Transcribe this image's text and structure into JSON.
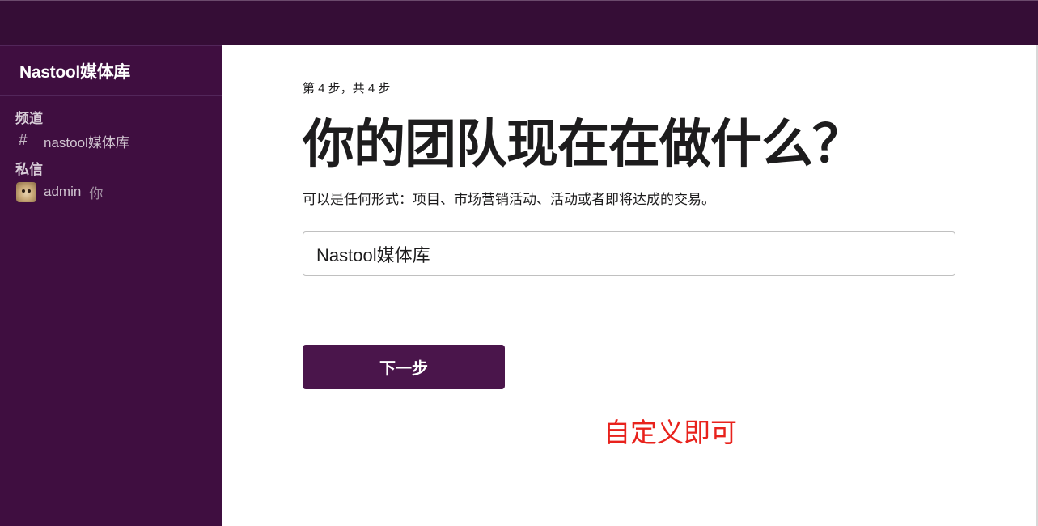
{
  "sidebar": {
    "workspace_name": "Nastool媒体库",
    "channels_label": "频道",
    "channels": [
      {
        "icon": "hash-icon",
        "label": "nastool媒体库"
      }
    ],
    "dms_label": "私信",
    "dms": [
      {
        "name": "admin",
        "suffix": "你"
      }
    ]
  },
  "main": {
    "step_indicator": "第 4 步，共 4 步",
    "title": "你的团队现在在做什么？",
    "subtitle": "可以是任何形式：项目、市场营销活动、活动或者即将达成的交易。",
    "team_input": {
      "value": "Nastool媒体库"
    },
    "next_button_label": "下一步",
    "annotation": "自定义即可"
  },
  "colors": {
    "topbar": "#350d36",
    "sidebar": "#3f0e40",
    "button": "#4a154b",
    "annotation": "#e8221c"
  }
}
